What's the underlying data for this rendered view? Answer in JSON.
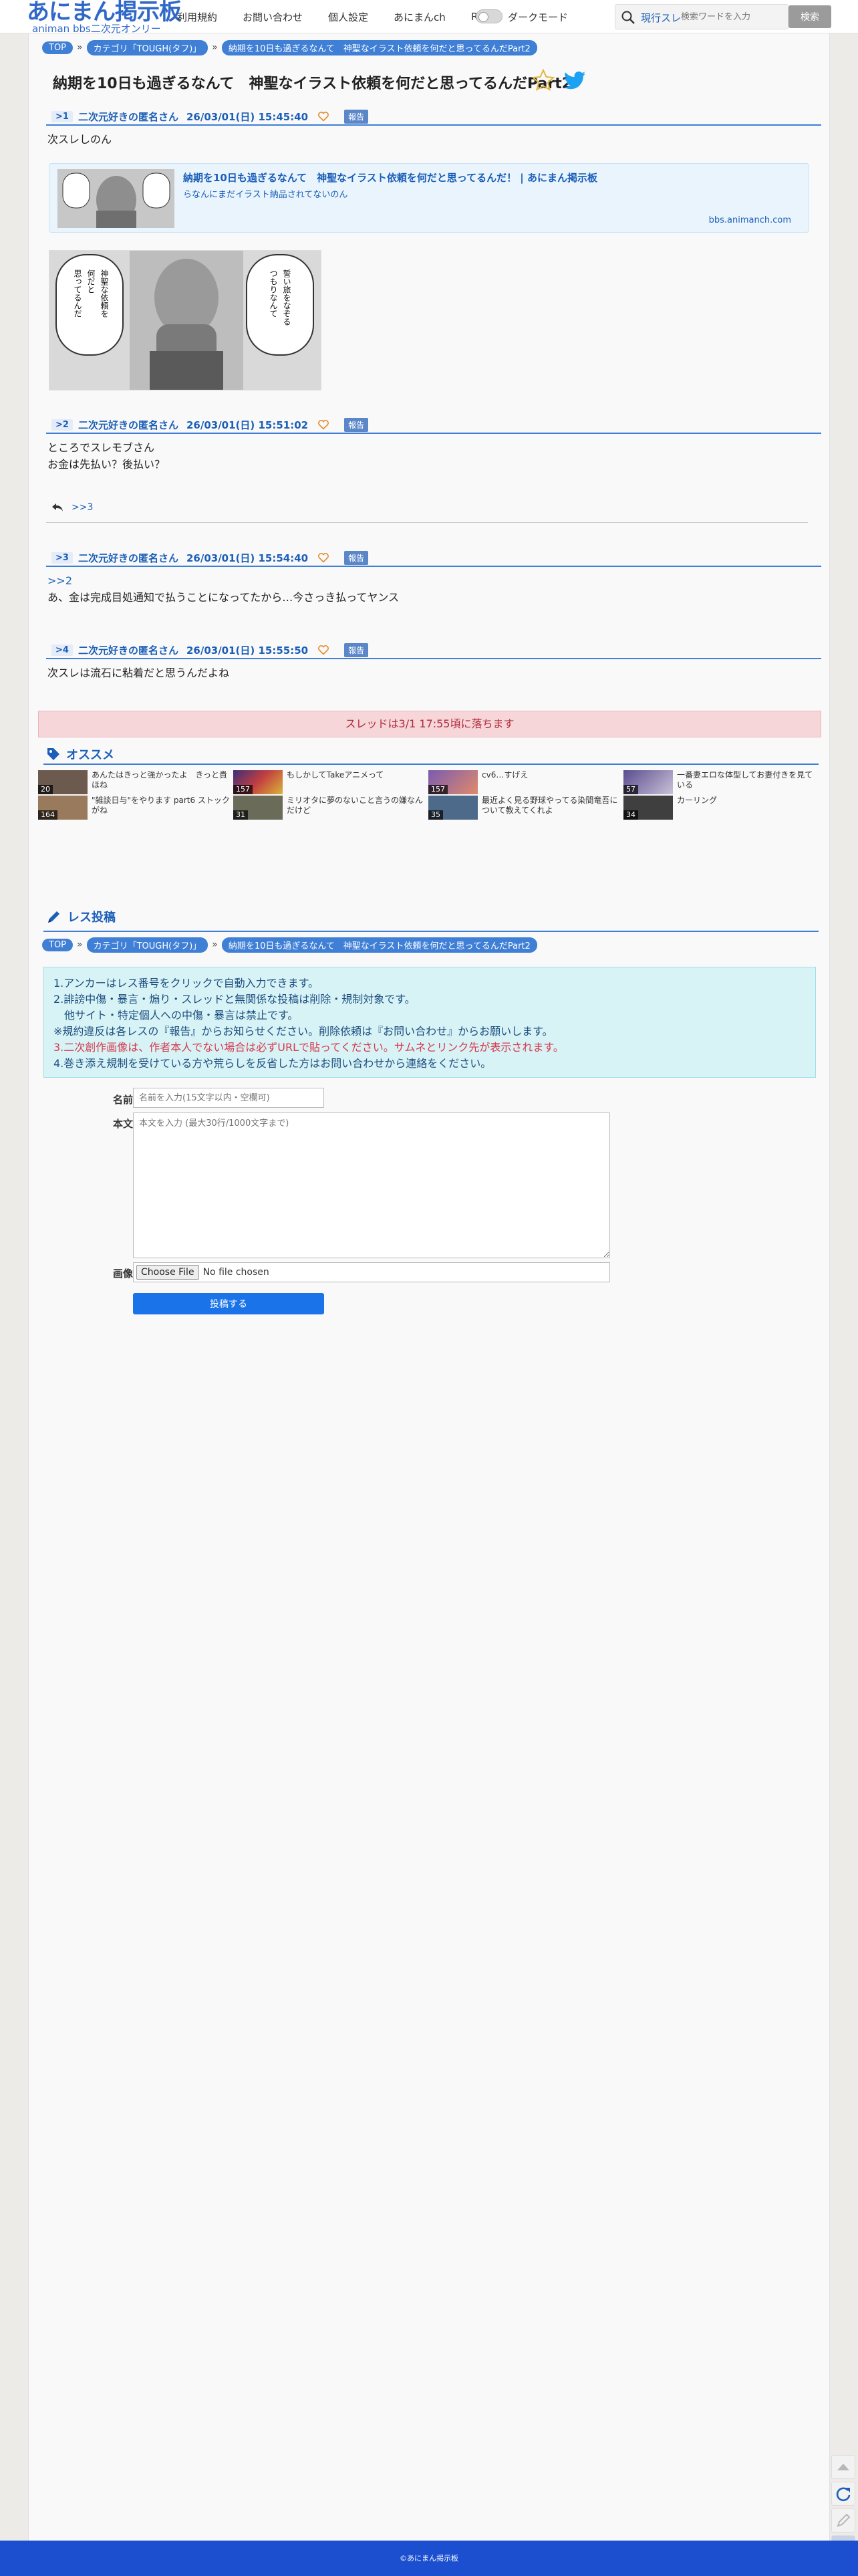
{
  "header": {
    "logo_main": "あにまん掲示板",
    "logo_sub": "animan bbs二次元オンリー",
    "nav": [
      "利用規約",
      "お問い合わせ",
      "個人設定",
      "あにまんch",
      "RSS"
    ],
    "dark_mode_label": "ダークモード",
    "search_scope": "現行スレ",
    "search_placeholder": "検索ワードを入力",
    "search_button": "検索"
  },
  "breadcrumbs": [
    "TOP",
    "カテゴリ「TOUGH(タフ)」",
    "納期を10日も過ぎるなんて　神聖なイラスト依頼を何だと思ってるんだPart2"
  ],
  "thread": {
    "title": "納期を10日も過ぎるなんて　神聖なイラスト依頼を何だと思ってるんだPart2"
  },
  "posts": [
    {
      "num": ">1",
      "name": "二次元好きの匿名さん",
      "date": "26/03/01(日) 15:45:40",
      "report": "報告",
      "lines": [
        "次スレしのん"
      ],
      "card": {
        "title": "納期を10日も過ぎるなんて　神聖なイラスト依頼を何だと思ってるんだ！ | あにまん掲示板",
        "desc": "らなんにまだイラスト納品されてないのん",
        "site": "bbs.animanch.com"
      },
      "image_bubbles": [
        "神聖な依頼を",
        "何だと",
        "思ってるんだ",
        "誓い旅をなぞる",
        "つもりなんて"
      ]
    },
    {
      "num": ">2",
      "name": "二次元好きの匿名さん",
      "date": "26/03/01(日) 15:51:02",
      "report": "報告",
      "lines": [
        "ところでスレモブさん",
        "お金は先払い？後払い？"
      ],
      "reply": ">>3"
    },
    {
      "num": ">3",
      "name": "二次元好きの匿名さん",
      "date": "26/03/01(日) 15:54:40",
      "report": "報告",
      "anchor": ">>2",
      "lines": [
        "あ、金は完成目処通知で払うことになってたから…今さっき払ってヤンス"
      ]
    },
    {
      "num": ">4",
      "name": "二次元好きの匿名さん",
      "date": "26/03/01(日) 15:55:50",
      "report": "報告",
      "lines": [
        "次スレは流石に粘着だと思うんだよね"
      ]
    }
  ],
  "expired_notice": "スレッドは3/1 17:55頃に落ちます",
  "recommend": {
    "heading": "オススメ",
    "items": [
      {
        "title": "あんたはきっと強かったよ　きっと貴ほね",
        "count": "20"
      },
      {
        "title": "もしかしてTakeアニメって",
        "count": "157"
      },
      {
        "title": "cv6…すげえ",
        "count": "157"
      },
      {
        "title": "一番妻エロな体型してお妻付きを見ている",
        "count": "57"
      },
      {
        "title": "\"雑談日与\"をやります part6 ストックがね",
        "count": "164"
      },
      {
        "title": "ミリオタに夢のないこと言うの嫌なんだけど",
        "count": "31"
      },
      {
        "title": "最近よく見る野球やってる染間竜吾について教えてくれよ",
        "count": "35"
      },
      {
        "title": "カーリング",
        "count": "34"
      }
    ]
  },
  "form": {
    "heading": "レス投稿",
    "notice_lines": [
      "1.アンカーはレス番号をクリックで自動入力できます。",
      "2.誹謗中傷・暴言・煽り・スレッドと無関係な投稿は削除・規制対象です。",
      "　他サイト・特定個人への中傷・暴言は禁止です。",
      "※規約違反は各レスの『報告』からお知らせください。削除依頼は『お問い合わせ』からお願いします。",
      "3.二次創作画像は、作者本人でない場合は必ずURLで貼ってください。サムネとリンク先が表示されます。",
      "4.巻き添え規制を受けている方や荒らしを反省した方はお問い合わせから連絡をください。"
    ],
    "name_label": "名前",
    "name_placeholder": "名前を入力(15文字以内・空欄可)",
    "body_label": "本文",
    "body_placeholder": "本文を入力 (最大30行/1000文字まで)",
    "image_label": "画像",
    "file_button": "Choose File",
    "file_status": "No file chosen",
    "submit": "投稿する"
  },
  "footer": "©あにまん掲示板",
  "colors": {
    "accent": "#3f7fd6",
    "link": "#1c5fb8",
    "footer": "#1b4fd0",
    "expired_bg": "#f6d6d9",
    "notice_bg": "#d8f3f6"
  },
  "side_icons": [
    "arrow-up-icon",
    "refresh-icon",
    "edit-icon",
    "gear-icon"
  ]
}
